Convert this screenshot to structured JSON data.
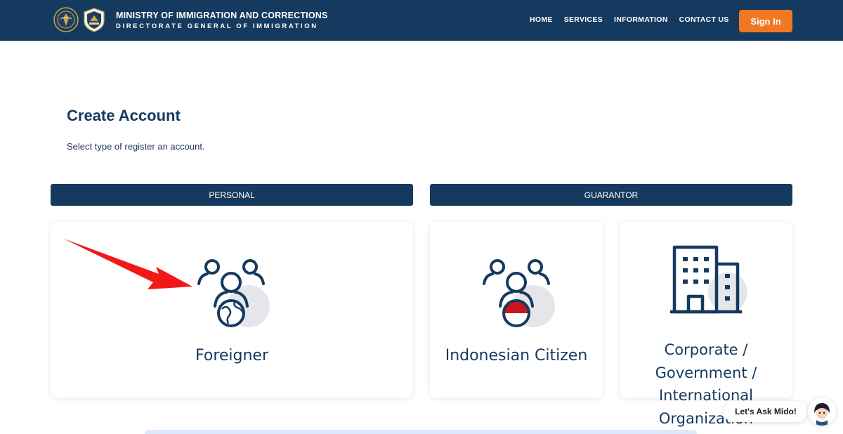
{
  "header": {
    "title_line1": "MINISTRY OF IMMIGRATION AND CORRECTIONS",
    "title_line2": "DIRECTORATE GENERAL OF IMMIGRATION",
    "nav": [
      "HOME",
      "SERVICES",
      "INFORMATION",
      "CONTACT US"
    ],
    "signin_label": "Sign In",
    "colors": {
      "primary": "#153a5f",
      "accent": "#f07822"
    }
  },
  "main": {
    "title": "Create Account",
    "subtitle": "Select type of register an account.",
    "sections": [
      "PERSONAL",
      "GUARANTOR"
    ],
    "cards": [
      {
        "label": "Foreigner",
        "icon": "people-globe-icon"
      },
      {
        "label": "Indonesian Citizen",
        "icon": "people-flag-icon"
      },
      {
        "label_lines": [
          "Corporate /",
          "Government /",
          "International",
          "Organization"
        ],
        "icon": "building-icon"
      }
    ]
  },
  "annotation": {
    "icon": "red-arrow-icon",
    "color": "#f21818"
  },
  "chat": {
    "label": "Let's Ask Mido!"
  }
}
